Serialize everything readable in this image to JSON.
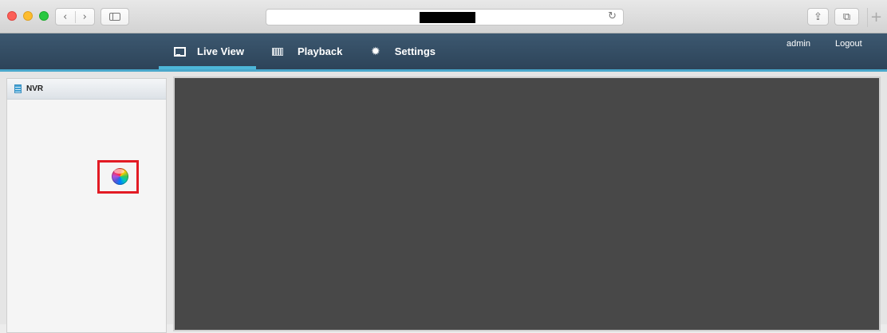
{
  "browser": {
    "nav_back": "‹",
    "nav_forward": "›",
    "reload_glyph": "↻",
    "share_glyph": "⇪",
    "tabs_glyph": "⧉",
    "new_tab_glyph": "+",
    "icons": [
      "close-icon",
      "minimize-icon",
      "maximize-icon",
      "sidebar-icon",
      "reload-icon",
      "share-icon",
      "tabs-icon"
    ]
  },
  "app": {
    "tabs": [
      {
        "label": "Live View",
        "icon": "monitor-icon",
        "active": true
      },
      {
        "label": "Playback",
        "icon": "film-icon",
        "active": false
      },
      {
        "label": "Settings",
        "icon": "gear-icon",
        "active": false
      }
    ],
    "gear_glyph": "✹",
    "user": "admin",
    "logout": "Logout"
  },
  "left_panel": {
    "title": "NVR",
    "loading_icon": "spinning-wheel-icon"
  },
  "colors": {
    "header": "#2f475d",
    "active_underline": "#4db6d8",
    "video_bg": "#484848",
    "highlight": "#e21b24"
  }
}
